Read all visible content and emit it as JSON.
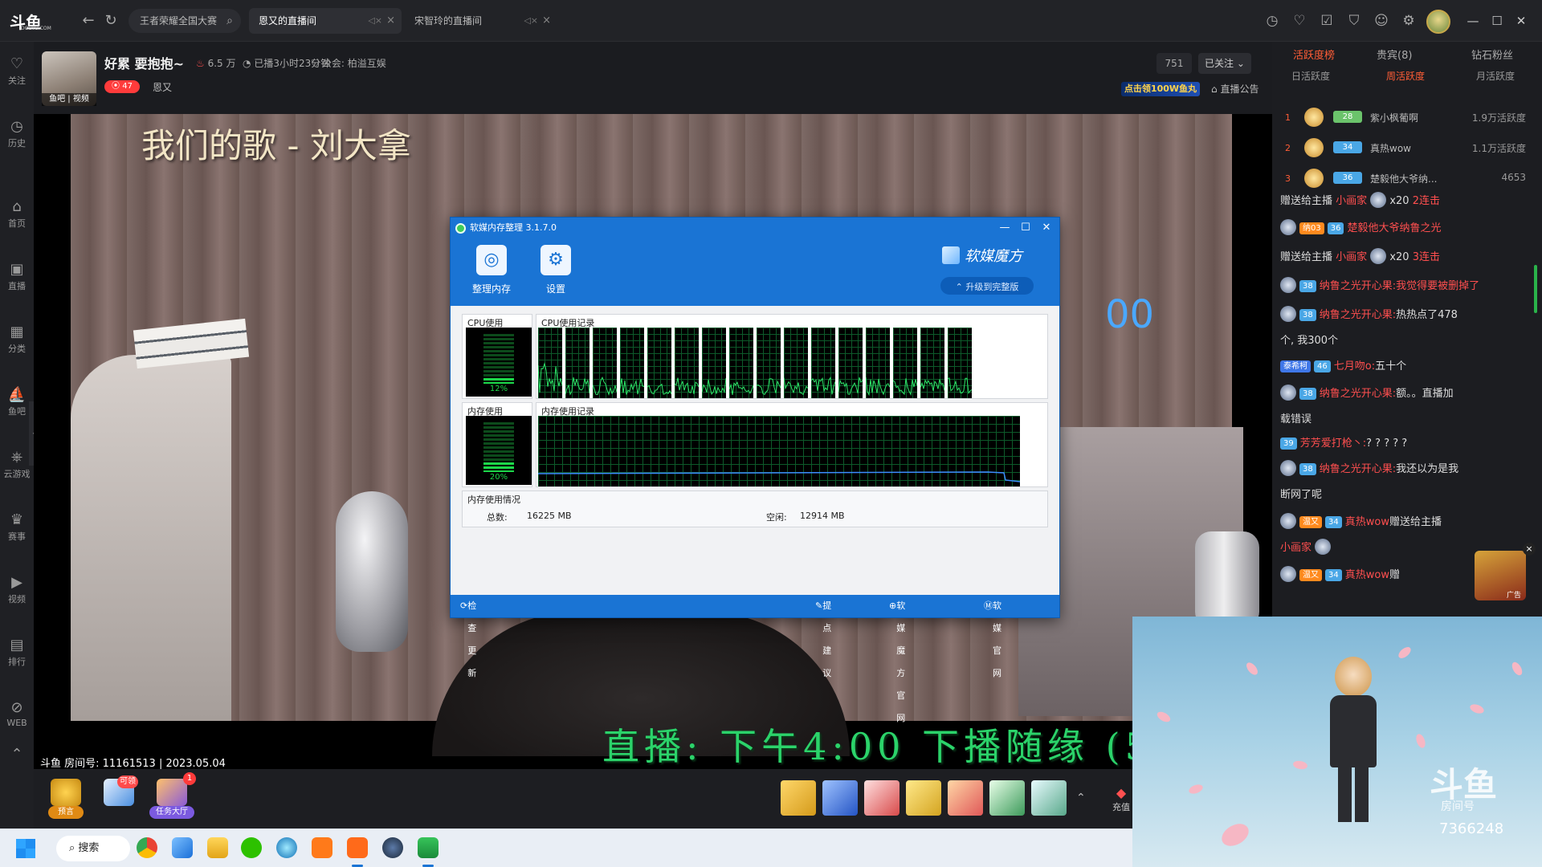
{
  "titlebar": {
    "logo_text": "斗鱼",
    "logo_sub": "DOUYU.COM",
    "search_text": "王者荣耀全国大赛",
    "tabs": [
      {
        "label": "恩又的直播间",
        "active": true
      },
      {
        "label": "宋智玲的直播间",
        "active": false
      }
    ]
  },
  "sidebar": {
    "items": [
      {
        "label": "关注",
        "icon": "heart-icon"
      },
      {
        "label": "历史",
        "icon": "clock-icon"
      },
      {
        "label": "首页",
        "icon": "home-icon"
      },
      {
        "label": "直播",
        "icon": "tv-icon"
      },
      {
        "label": "分类",
        "icon": "grid-icon"
      },
      {
        "label": "鱼吧",
        "icon": "fish-icon"
      },
      {
        "label": "云游戏",
        "icon": "gamepad-icon"
      },
      {
        "label": "赛事",
        "icon": "trophy-icon"
      },
      {
        "label": "视频",
        "icon": "video-icon"
      },
      {
        "label": "排行",
        "icon": "ranking-icon"
      },
      {
        "label": "WEB",
        "icon": "web-icon"
      }
    ]
  },
  "room": {
    "avatar_label": "鱼吧 | 视频",
    "title": "好累 要抱抱~",
    "hot": "6.5 万",
    "live_time": "已播3小时23分钟",
    "guild": "公会: 柏溢互娱",
    "level": "47",
    "anchor_name": "恩又",
    "fans": "751",
    "follow_label": "已关注",
    "promo": "点击领100W鱼丸",
    "notice": "直播公告"
  },
  "video": {
    "song_title": "我们的歌 - 刘大拿",
    "ticker": "直播: 下午4:00 下播随缘 (5",
    "overlay_digits": "00",
    "room_info": "斗鱼 房间号: 11161513 | 2023.05.04"
  },
  "mem_window": {
    "title": "软媒内存整理 3.1.7.0",
    "tool_clean": "整理内存",
    "tool_settings": "设置",
    "brand": "软媒魔方",
    "upgrade": "升级到完整版",
    "cpu_usage_label": "CPU使用",
    "cpu_history_label": "CPU使用记录",
    "cpu_percent": "12%",
    "cpu_fill": 0.12,
    "mem_usage_label": "内存使用",
    "mem_history_label": "内存使用记录",
    "mem_percent": "20%",
    "mem_fill": 0.2,
    "mem_info_label": "内存使用情况",
    "total_label": "总数:",
    "total_value": "16225 MB",
    "free_label": "空闲:",
    "free_value": "12914 MB",
    "check_update": "检查更新",
    "suggest": "提点建议",
    "official_site": "软媒魔方官网",
    "ruanmei_site": "软媒官网"
  },
  "giftbar": {
    "predict": "预言",
    "gift_pack_badge": "可领",
    "task_hall": "任务大厅",
    "task_badge": "1",
    "recharge": "充值"
  },
  "rpanel": {
    "tabs": [
      "活跃度榜",
      "贵宾(8)",
      "钻石粉丝"
    ],
    "subtabs": [
      "日活跃度",
      "周活跃度",
      "月活跃度"
    ],
    "ranking": [
      {
        "no": "1",
        "level": "28",
        "name": "紫小枫葡啊",
        "score": "1.9万活跃度"
      },
      {
        "no": "2",
        "level": "34",
        "name": "真热wow",
        "score": "1.1万活跃度"
      },
      {
        "no": "3",
        "level": "36",
        "name": "楚毅他大爷纳...",
        "score": "4653"
      }
    ],
    "messages": [
      {
        "pre": "赠送给主播",
        "user": "小画家",
        "post": "x20",
        "combo": "2连击"
      },
      {
        "badge": "纳03",
        "level": "36",
        "user": "楚毅他大爷纳鲁之光"
      },
      {
        "pre": "赠送给主播",
        "user": "小画家",
        "post": "x20",
        "combo": "3连击"
      },
      {
        "level": "38",
        "user": "纳鲁之光开心果:",
        "text": "我觉得要被删掉了"
      },
      {
        "level": "38",
        "user": "纳鲁之光开心果:",
        "text": "热热点了478"
      },
      {
        "text": "个, 我300个"
      },
      {
        "badge": "泰希柯",
        "level": "46",
        "user": "七月吻o:",
        "text": "五十个"
      },
      {
        "level": "38",
        "user": "纳鲁之光开心果:",
        "text": "额。。直播加"
      },
      {
        "text": "载错误"
      },
      {
        "level": "39",
        "user": "芳芳爱打枪丶:",
        "text": "? ? ? ? ?"
      },
      {
        "level": "38",
        "user": "纳鲁之光开心果:",
        "text": "我还以为是我"
      },
      {
        "text": "断网了呢"
      },
      {
        "badge": "温又",
        "level": "34",
        "user": "真热wow",
        "text": "赠送给主播"
      },
      {
        "text": "小画家"
      },
      {
        "badge": "温又",
        "level": "34",
        "user": "真热wow",
        "text": "赠"
      }
    ],
    "ad_label": "广告"
  },
  "avatar_win": {
    "logo": "斗鱼",
    "sub": "房间号",
    "room_no": "7366248"
  },
  "taskbar": {
    "search": "搜索"
  }
}
